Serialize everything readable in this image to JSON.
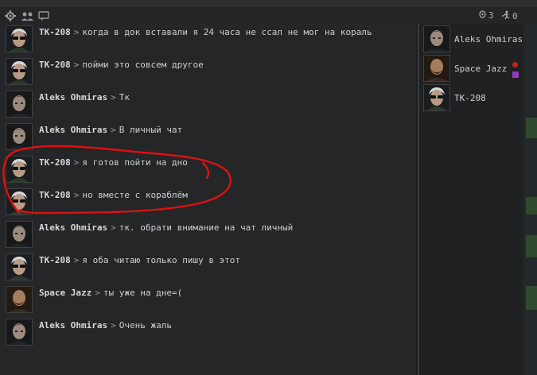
{
  "toolbar": {
    "counter_viewers": "3",
    "counter_pilots": "0"
  },
  "messages": [
    {
      "sender": "TK-208",
      "text": "когда в док вставали я 24 часа не ссал не мог на кораль",
      "avatar": "glasses"
    },
    {
      "sender": "TK-208",
      "text": "пойми это совсем другое",
      "avatar": "glasses"
    },
    {
      "sender": "Aleks Ohmiras",
      "text": "Тк",
      "avatar": "dark"
    },
    {
      "sender": "Aleks Ohmiras",
      "text": "В личный чат",
      "avatar": "dark"
    },
    {
      "sender": "TK-208",
      "text": "я готов пойти на дно",
      "avatar": "glasses"
    },
    {
      "sender": "TK-208",
      "text": "но вместе с кораблём",
      "avatar": "glasses"
    },
    {
      "sender": "Aleks Ohmiras",
      "text": "тк. обрати внимание на чат личный",
      "avatar": "dark"
    },
    {
      "sender": "TK-208",
      "text": "я оба читаю только пишу в этот",
      "avatar": "glasses"
    },
    {
      "sender": "Space Jazz",
      "text": "ты уже на дне=(",
      "avatar": "beard"
    },
    {
      "sender": "Aleks Ohmiras",
      "text": "Очень жаль",
      "avatar": "dark"
    }
  ],
  "separator": ">",
  "members": [
    {
      "name": "Aleks Ohmiras",
      "avatar": "dark"
    },
    {
      "name": "Space Jazz",
      "avatar": "beard"
    },
    {
      "name": "TK-208",
      "avatar": "glasses"
    }
  ],
  "colors": {
    "annotation": "#e01010",
    "status_red": "#c81e1e",
    "status_purple": "#8a3fbf"
  }
}
